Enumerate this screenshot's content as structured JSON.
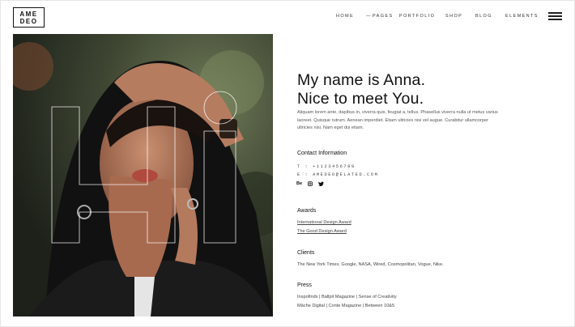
{
  "brand": {
    "logo_line1": "AME",
    "logo_line2": "DEO"
  },
  "nav": {
    "items": [
      "HOME",
      "PAGES",
      "PORTFOLIO",
      "SHOP",
      "BLOG",
      "ELEMENTS"
    ],
    "pages_prefix": "—"
  },
  "hero": {
    "overlay_text": "Hi"
  },
  "intro": {
    "heading_line1": "My name is Anna.",
    "heading_line2": "Nice to meet You.",
    "body": "Aliquam lorem ante, dapibus in, viverra quis, feugiat a, tellus. Phasellus viverra nulla ut metus varius laoreet. Quisque rutrum. Aenean imperdiet. Etiam ultricies nisi vel augue. Curabitur ullamcorper ultricies nisi. Nam eget dui etiam."
  },
  "contact": {
    "title": "Contact Information",
    "phone_label": "T :",
    "phone": "+1123456789",
    "email_label": "E :",
    "email": "AMEDEO@ELATED.COM",
    "social": [
      "Be",
      "instagram-icon",
      "twitter-icon"
    ]
  },
  "awards": {
    "title": "Awards",
    "items": [
      "International Design Award",
      "The Good Design Award"
    ]
  },
  "clients": {
    "title": "Clients",
    "text": "The New York Times, Google, NASA, Wired, Cosmopolitan, Vogue, Nike."
  },
  "press": {
    "title": "Press",
    "line1": "Inspofinds | Ballpit Magazine | Sense of Creativity",
    "line2": "Mâche Digital | Conte Magazine | Between 10&5"
  }
}
